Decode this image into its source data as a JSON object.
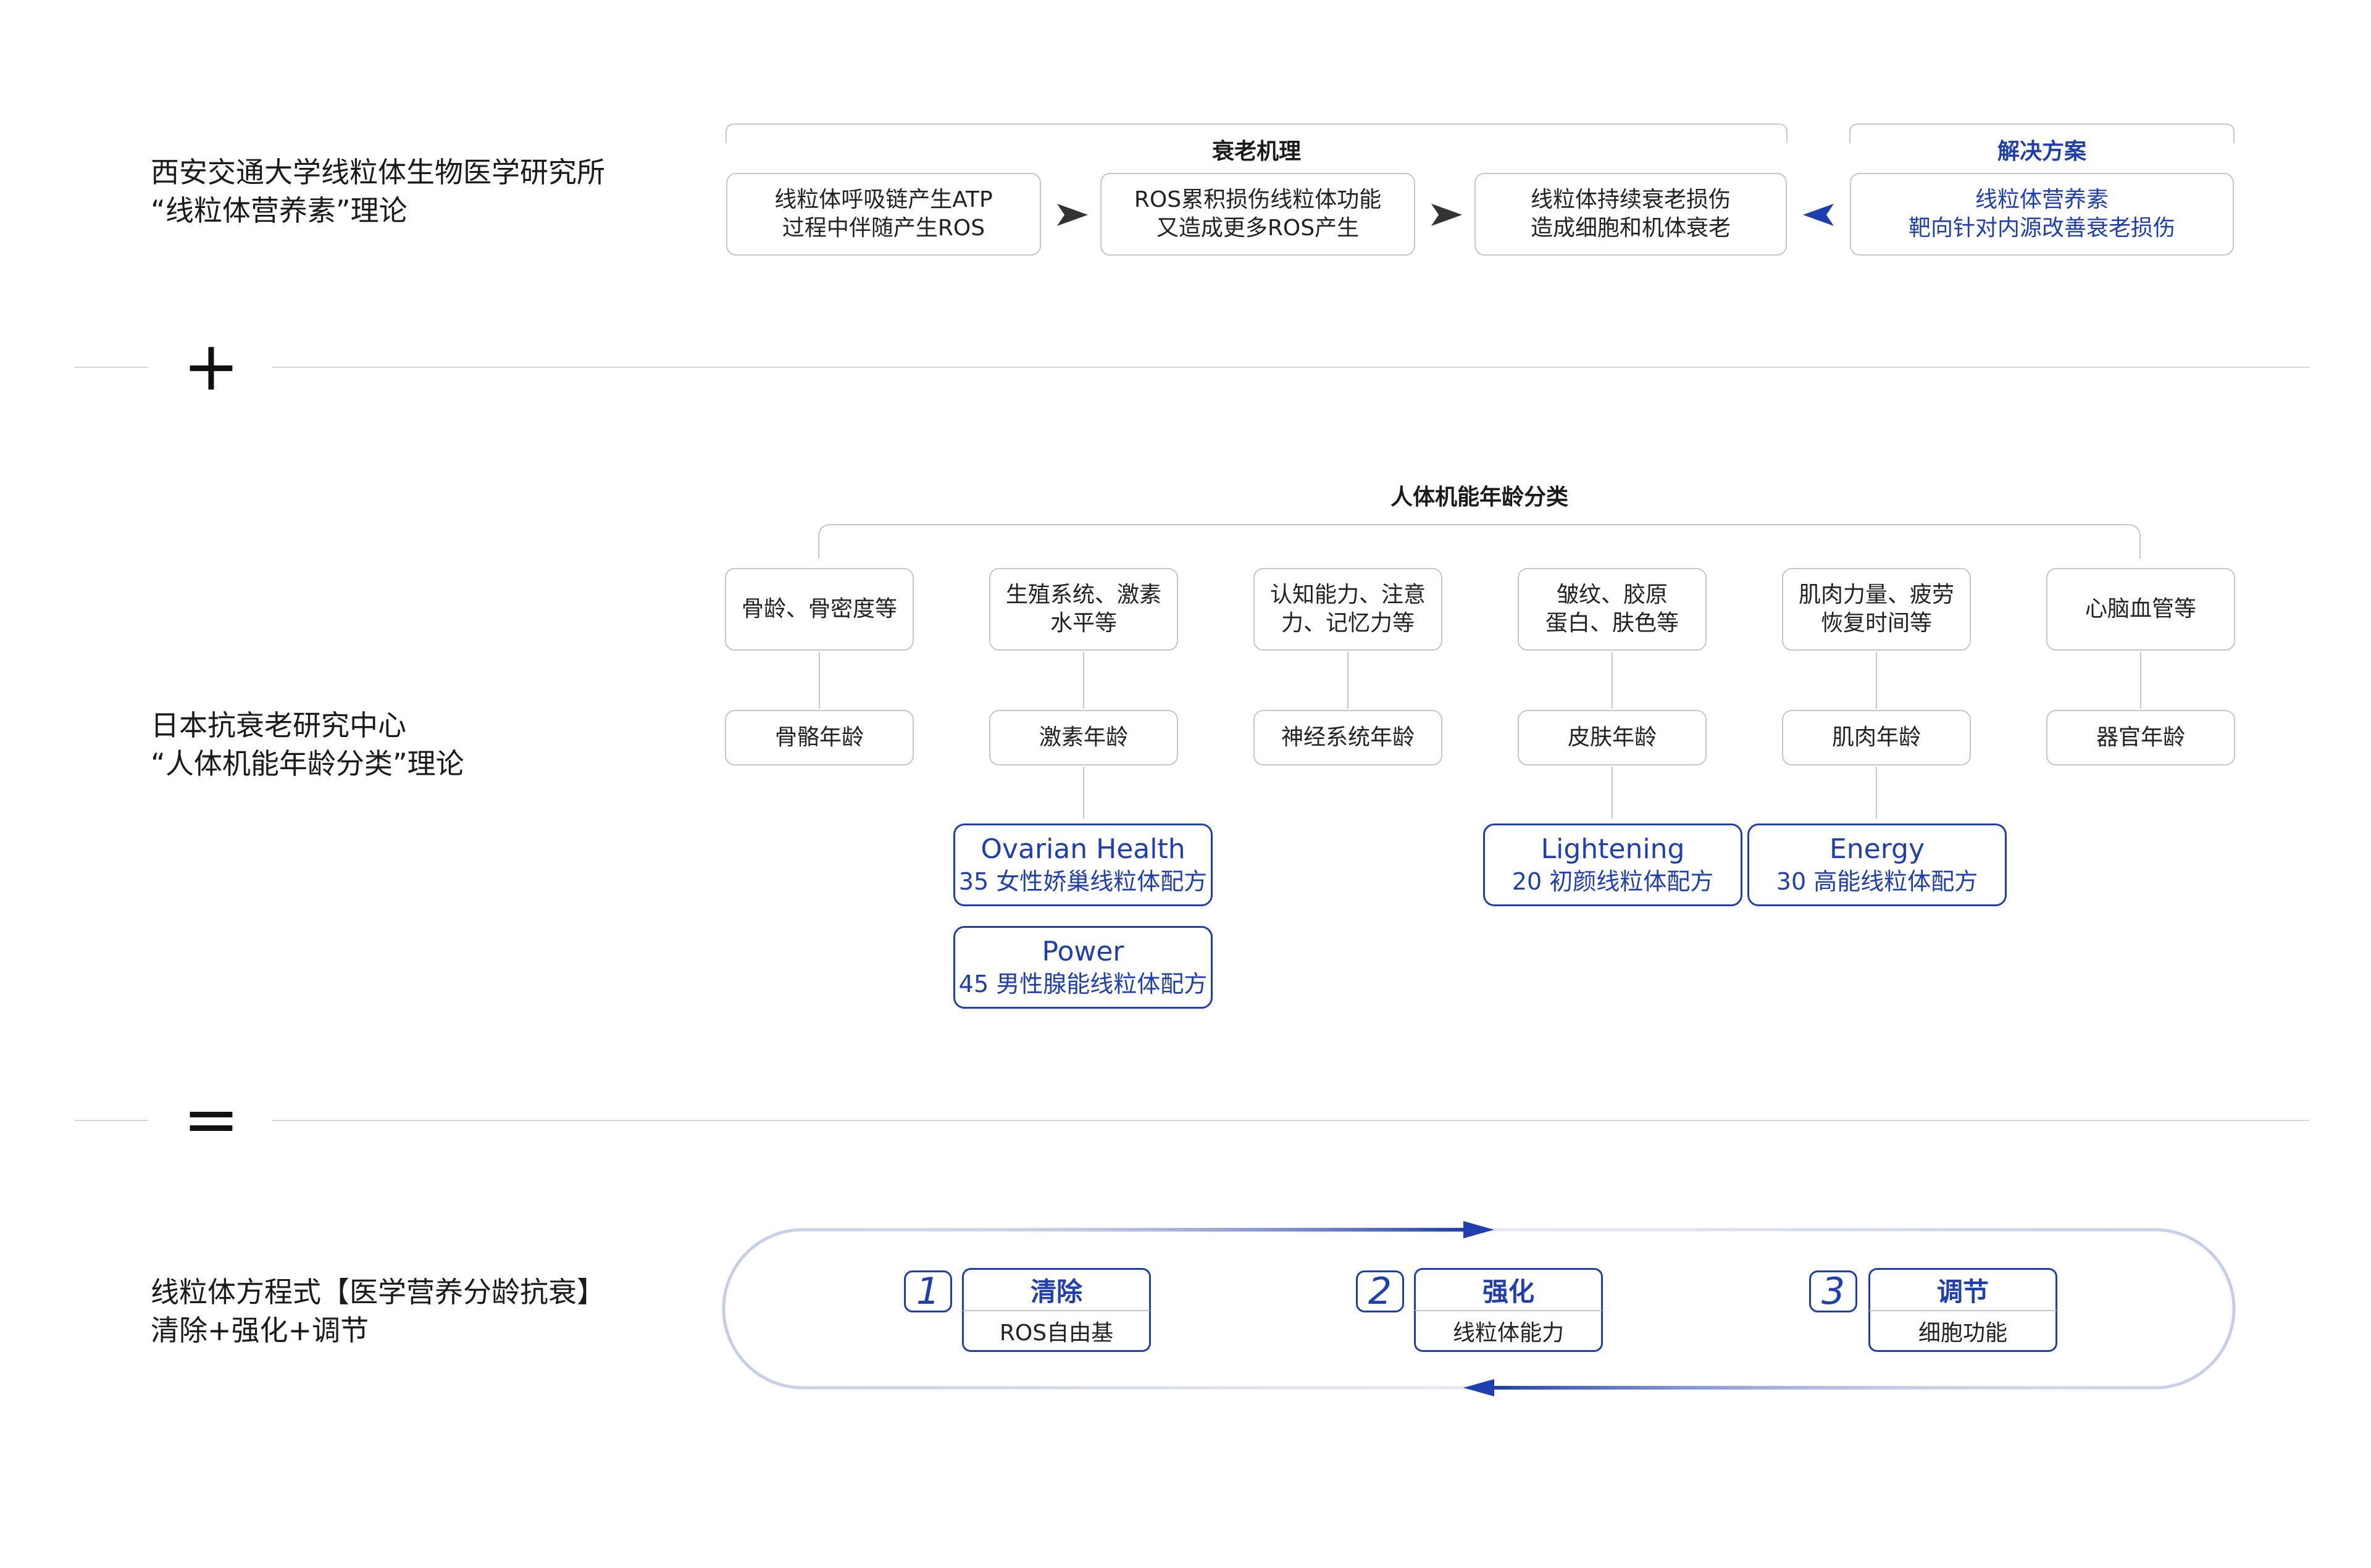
{
  "sections": {
    "s1": {
      "line1": "西安交通大学线粒体生物医学研究所",
      "line2": "“线粒体营养素”理论"
    },
    "s2": {
      "line1": "日本抗衰老研究中心",
      "line2": "“人体机能年龄分类”理论"
    },
    "s3": {
      "line1": "线粒体方程式【医学营养分龄抗衰】",
      "line2": "清除+强化+调节"
    }
  },
  "operators": {
    "plus": "+",
    "equals": "="
  },
  "aging": {
    "title": "衰老机理",
    "boxes": [
      {
        "l1": "线粒体呼吸链产生ATP",
        "l2": "过程中伴随产生ROS"
      },
      {
        "l1": "ROS累积损伤线粒体功能",
        "l2": "又造成更多ROS产生"
      },
      {
        "l1": "线粒体持续衰老损伤",
        "l2": "造成细胞和机体衰老"
      }
    ]
  },
  "solution": {
    "title": "解决方案",
    "l1": "线粒体营养素",
    "l2": "靶向针对内源改善衰老损伤"
  },
  "classification": {
    "title": "人体机能年龄分类",
    "columns": [
      {
        "top1": "骨龄、骨密度等",
        "top2": "",
        "age": "骨骼年龄"
      },
      {
        "top1": "生殖系统、激素",
        "top2": "水平等",
        "age": "激素年龄"
      },
      {
        "top1": "认知能力、注意",
        "top2": "力、记忆力等",
        "age": "神经系统年龄"
      },
      {
        "top1": "皱纹、胶原",
        "top2": "蛋白、肤色等",
        "age": "皮肤年龄"
      },
      {
        "top1": "肌肉力量、疲劳",
        "top2": "恢复时间等",
        "age": "肌肉年龄"
      },
      {
        "top1": "心脑血管等",
        "top2": "",
        "age": "器官年龄"
      }
    ],
    "products": [
      {
        "en": "Ovarian Health",
        "cn": "35 女性娇巢线粒体配方"
      },
      {
        "en": "Power",
        "cn": "45 男性腺能线粒体配方"
      },
      {
        "en": "Lightening",
        "cn": "20 初颜线粒体配方"
      },
      {
        "en": "Energy",
        "cn": "30 高能线粒体配方"
      }
    ]
  },
  "steps": [
    {
      "num": "1",
      "title": "清除",
      "desc": "ROS自由基"
    },
    {
      "num": "2",
      "title": "强化",
      "desc": "线粒体能力"
    },
    {
      "num": "3",
      "title": "调节",
      "desc": "细胞功能"
    }
  ],
  "colors": {
    "accent": "#1f3fb0",
    "border": "#c7c7c7",
    "text": "#1a1a1a"
  }
}
